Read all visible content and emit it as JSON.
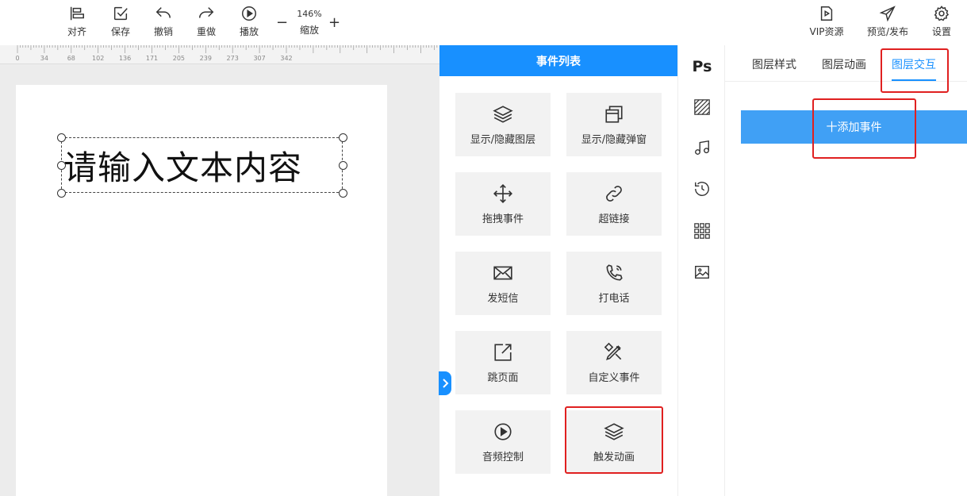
{
  "toolbar": {
    "align": "对齐",
    "save": "保存",
    "undo": "撤销",
    "redo": "重做",
    "play": "播放",
    "zoom_percent": "146%",
    "zoom_label": "缩放",
    "zoom_minus": "−",
    "zoom_plus": "+",
    "vip": "VIP资源",
    "publish": "预览/发布",
    "settings": "设置"
  },
  "ruler": {
    "ticks": [
      "0",
      "34",
      "68",
      "102",
      "136",
      "171",
      "205",
      "239",
      "273",
      "307",
      "342"
    ]
  },
  "canvas": {
    "text_layer": "请输入文本内容"
  },
  "event_panel": {
    "title": "事件列表",
    "items": [
      {
        "label": "显示/隐藏图层",
        "icon": "layers-icon"
      },
      {
        "label": "显示/隐藏弹窗",
        "icon": "popup-icon"
      },
      {
        "label": "拖拽事件",
        "icon": "move-icon"
      },
      {
        "label": "超链接",
        "icon": "link-icon"
      },
      {
        "label": "发短信",
        "icon": "mail-icon"
      },
      {
        "label": "打电话",
        "icon": "phone-icon"
      },
      {
        "label": "跳页面",
        "icon": "external-link-icon"
      },
      {
        "label": "自定义事件",
        "icon": "tools-icon"
      },
      {
        "label": "音频控制",
        "icon": "play-circle-icon"
      },
      {
        "label": "触发动画",
        "icon": "layers-icon"
      }
    ]
  },
  "icon_strip": {
    "ps_label": "Ps"
  },
  "right_panel": {
    "tabs": [
      "图层样式",
      "图层动画",
      "图层交互"
    ],
    "active_tab": "图层交互",
    "add_event": "十添加事件"
  },
  "colors": {
    "accent": "#1890ff",
    "add_button": "#40a0f5",
    "highlight": "#e02020",
    "tile_bg": "#f2f2f2"
  }
}
